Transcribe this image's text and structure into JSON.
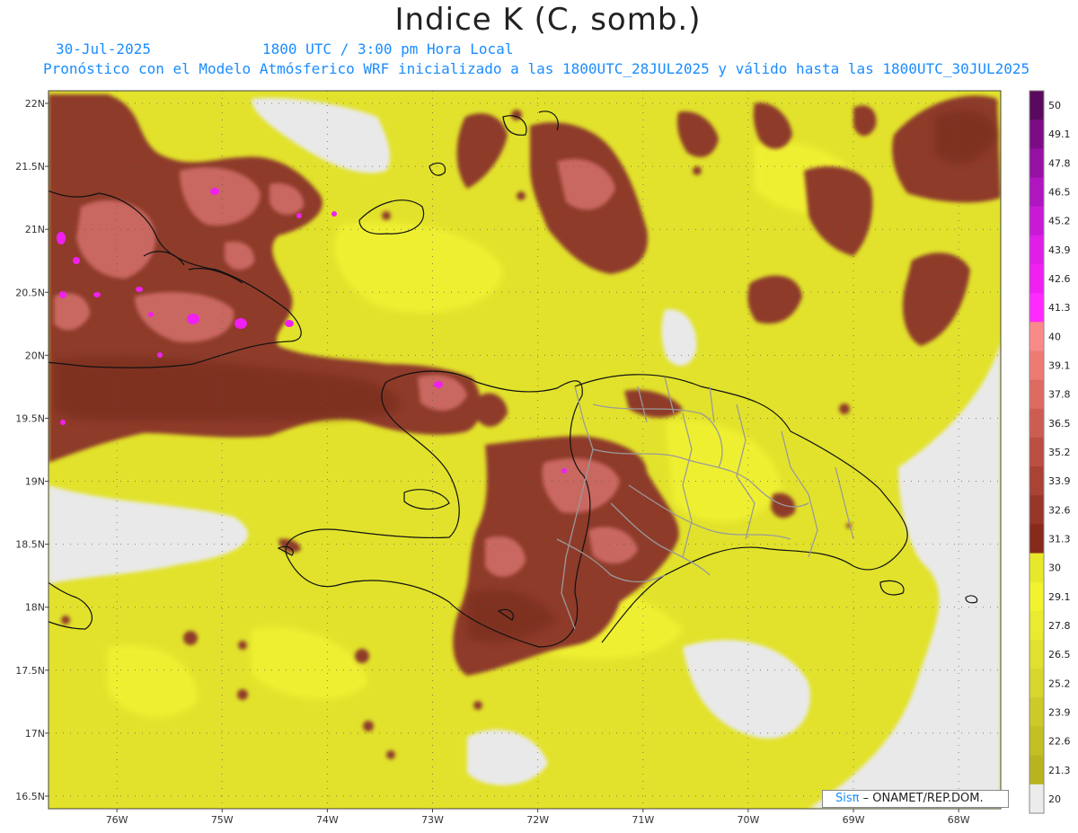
{
  "header": {
    "title": "Indice K (C, somb.)",
    "date": "30-Jul-2025",
    "time": "1800 UTC / 3:00 pm Hora Local",
    "description": "Pronóstico con el Modelo Atmósferico WRF inicializado a las 1800UTC_28JUL2025 y válido hasta las  1800UTC_30JUL2025"
  },
  "credit": {
    "sis": "Sisπ",
    "org": "– ONAMET/REP.DOM."
  },
  "map": {
    "lat_labels": [
      "22N",
      "21.5N",
      "21N",
      "20.5N",
      "20N",
      "19.5N",
      "19N",
      "18.5N",
      "18N",
      "17.5N",
      "17N",
      "16.5N"
    ],
    "lon_labels": [
      "76W",
      "75W",
      "74W",
      "73W",
      "72W",
      "71W",
      "70W",
      "69W",
      "68W"
    ],
    "lat_range": [
      16.4,
      22.1
    ],
    "lon_range": [
      -76.65,
      -67.6
    ]
  },
  "legend": {
    "labels": [
      "50",
      "49.1",
      "47.8",
      "46.5",
      "45.2",
      "43.9",
      "42.6",
      "41.3",
      "40",
      "39.1",
      "37.8",
      "36.5",
      "35.2",
      "33.9",
      "32.6",
      "31.3",
      "30",
      "29.1",
      "27.8",
      "26.5",
      "25.2",
      "23.9",
      "22.6",
      "21.3",
      "20"
    ],
    "colors": [
      "#5a0a5e",
      "#7b0c86",
      "#9611a4",
      "#b016c0",
      "#c81ad6",
      "#e01ee8",
      "#f020f0",
      "#ff2aff",
      "#fa8a8a",
      "#ef7a74",
      "#de6a62",
      "#cd5c52",
      "#bc4e44",
      "#aa4236",
      "#98362a",
      "#87291c",
      "#e8e82a",
      "#f2f22e",
      "#eaea2e",
      "#e0e02e",
      "#d6d62c",
      "#ccca28",
      "#c2c024",
      "#b8b420",
      "#ececec"
    ],
    "ranges": [
      "≤20",
      "20–21.3",
      "21.3–22.6",
      "22.6–23.9",
      "23.9–25.2",
      "25.2–26.5",
      "26.5–27.8",
      "27.8–29.1",
      "29.1–30",
      "30–31.3",
      "31.3–32.6",
      "32.6–33.9",
      "33.9–35.2",
      "35.2–36.5",
      "36.5–37.8",
      "37.8–39.1",
      "39.1–40",
      "40–41.3",
      "41.3–42.6",
      "42.6–43.9",
      "43.9–45.2",
      "45.2–46.5",
      "46.5–47.8",
      "47.8–49.1",
      "≥49.1"
    ]
  },
  "colors": {
    "title": "#222222",
    "subtitle": "#1a8cff",
    "ocean_low": "#e9e9e9",
    "moist": "#eaea2e",
    "high": "#8e3a2a",
    "peak": "#d86a6a",
    "extreme": "#f020f0"
  }
}
